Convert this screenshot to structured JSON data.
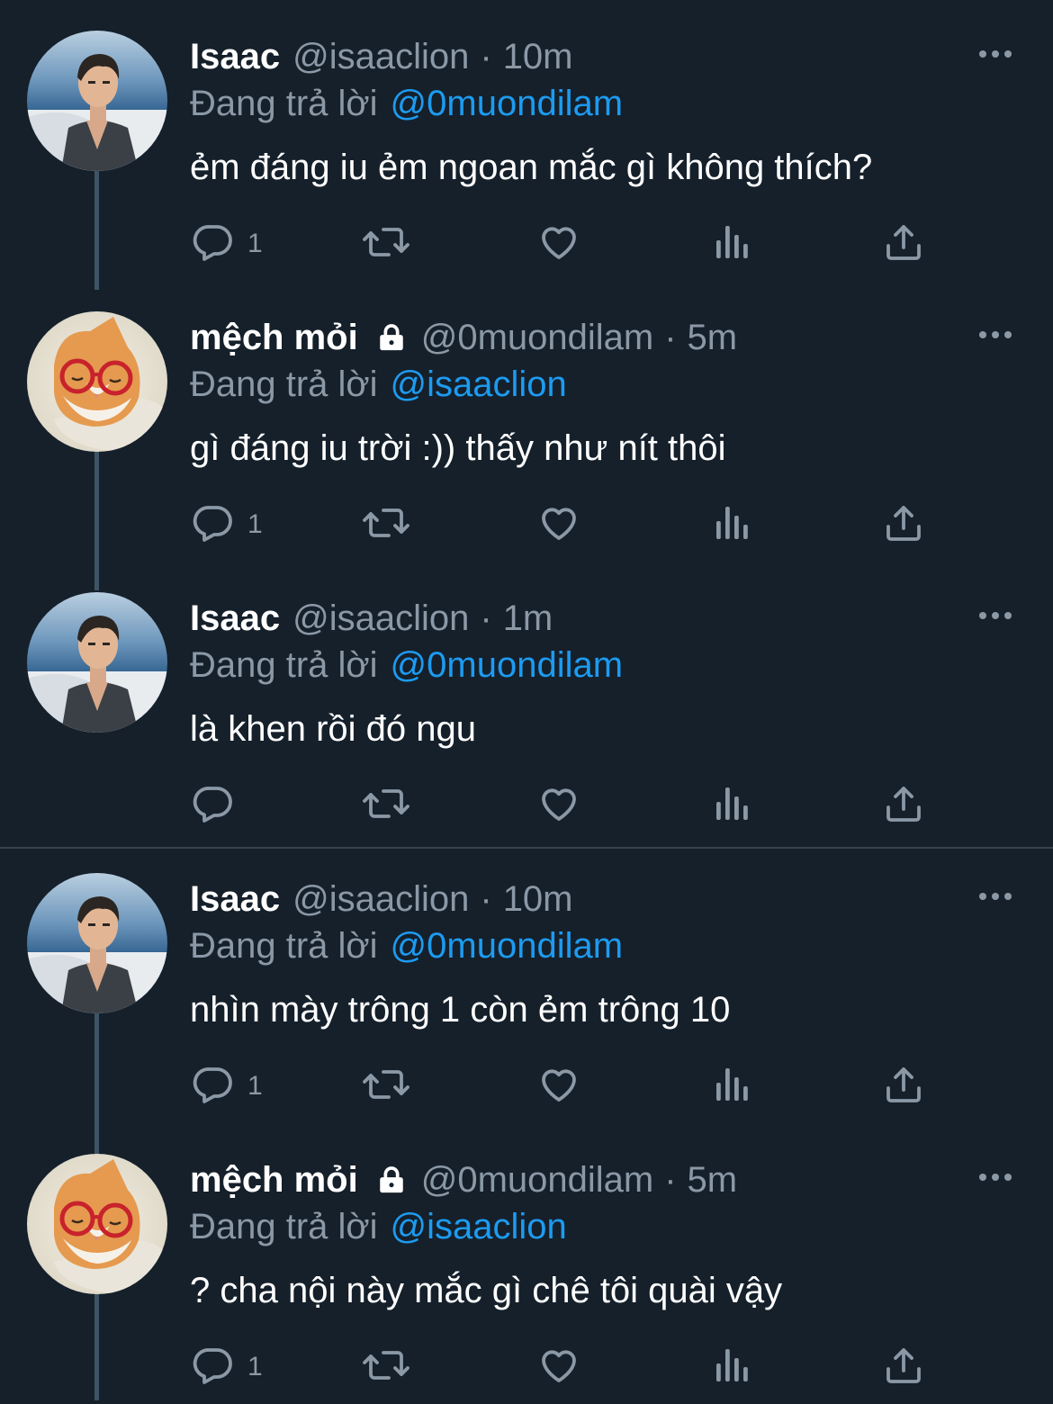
{
  "tweets": [
    {
      "avatar": "isaac-avatar",
      "name": "Isaac",
      "locked": false,
      "handle": "@isaaclion",
      "time": "10m",
      "replying_label": "Đang trả lời",
      "replying_to": "@0muondilam",
      "text": "ẻm đáng iu ẻm ngoan mắc gì không thích?",
      "reply_count": "1"
    },
    {
      "avatar": "cat-avatar",
      "name": "mệch mỏi",
      "locked": true,
      "handle": "@0muondilam",
      "time": "5m",
      "replying_label": "Đang trả lời",
      "replying_to": "@isaaclion",
      "text": "gì đáng iu trời :)) thấy như nít thôi",
      "reply_count": "1"
    },
    {
      "avatar": "isaac-avatar",
      "name": "Isaac",
      "locked": false,
      "handle": "@isaaclion",
      "time": "1m",
      "replying_label": "Đang trả lời",
      "replying_to": "@0muondilam",
      "text": "là khen rồi đó ngu",
      "reply_count": ""
    },
    {
      "avatar": "isaac-avatar",
      "name": "Isaac",
      "locked": false,
      "handle": "@isaaclion",
      "time": "10m",
      "replying_label": "Đang trả lời",
      "replying_to": "@0muondilam",
      "text": "nhìn mày trông 1 còn ẻm trông 10",
      "reply_count": "1"
    },
    {
      "avatar": "cat-avatar",
      "name": "mệch mỏi",
      "locked": true,
      "handle": "@0muondilam",
      "time": "5m",
      "replying_label": "Đang trả lời",
      "replying_to": "@isaaclion",
      "text": "? cha nội này mắc gì chê tôi quài vậy",
      "reply_count": "1"
    }
  ],
  "icons": {
    "reply": "reply-icon",
    "retweet": "retweet-icon",
    "like": "heart-icon",
    "views": "views-icon",
    "share": "share-icon",
    "more": "more-icon",
    "lock": "lock-icon"
  },
  "colors": {
    "background": "#15202b",
    "text": "#ffffff",
    "secondary": "#8b98a5",
    "mention": "#1d9bf0",
    "thread_line": "#3d5466",
    "divider": "#38444d"
  }
}
